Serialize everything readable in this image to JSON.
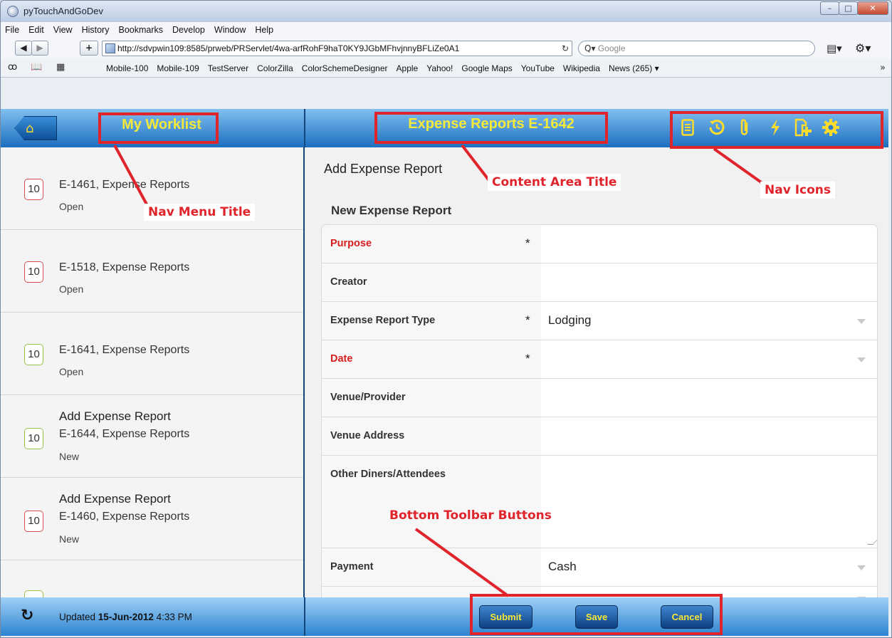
{
  "window": {
    "title": "pyTouchAndGoDev",
    "controls": {
      "minimize": "–",
      "maximize": "□",
      "close": "✕"
    }
  },
  "menubar": [
    "File",
    "Edit",
    "View",
    "History",
    "Bookmarks",
    "Develop",
    "Window",
    "Help"
  ],
  "toolbar": {
    "back": "◀",
    "forward": "▶",
    "add": "+",
    "url": "http://sdvpwin109:8585/prweb/PRServlet/4wa-arfRohF9haT0KY9JGbMFhvjnnyBFLiZe0A1",
    "reload": "↻",
    "search_placeholder": "Google",
    "search_glyph": "Q▾",
    "page_menu": "▤▾",
    "gear_menu": "⚙▾"
  },
  "bookmarks": {
    "items": [
      "Mobile-100",
      "Mobile-109",
      "TestServer",
      "ColorZilla",
      "ColorSchemeDesigner",
      "Apple",
      "Yahoo!",
      "Google Maps",
      "YouTube",
      "Wikipedia",
      "News (265) ▾"
    ],
    "more": "»"
  },
  "app": {
    "nav_title": "My Worklist",
    "content_title": "Expense Reports E-1642",
    "nav_icons": [
      "document-icon",
      "history-icon",
      "paperclip-icon",
      "lightning-icon",
      "add-page-icon",
      "gear-icon"
    ],
    "worklist": [
      {
        "priority": "10",
        "title": "",
        "line1": "E-1461, Expense Reports",
        "status": "Open",
        "badge": "red"
      },
      {
        "priority": "10",
        "title": "",
        "line1": "E-1518, Expense Reports",
        "status": "Open",
        "badge": "red"
      },
      {
        "priority": "10",
        "title": "",
        "line1": "E-1641, Expense Reports",
        "status": "Open",
        "badge": "green"
      },
      {
        "priority": "10",
        "title": "Add Expense Report",
        "line1": "E-1644, Expense Reports",
        "status": "New",
        "badge": "green"
      },
      {
        "priority": "10",
        "title": "Add Expense Report",
        "line1": "E-1460, Expense Reports",
        "status": "New",
        "badge": "red"
      },
      {
        "priority": "",
        "title": "",
        "line1": "",
        "status": "",
        "badge": "green"
      }
    ],
    "content": {
      "heading": "Add Expense Report",
      "subheading": "New Expense Report",
      "fields": [
        {
          "label": "Purpose",
          "required": true,
          "value": "",
          "dropdown": false
        },
        {
          "label": "Creator",
          "required": false,
          "value": "",
          "dropdown": false
        },
        {
          "label": "Expense Report Type",
          "required": true,
          "value": "Lodging",
          "dropdown": true
        },
        {
          "label": "Date",
          "required": true,
          "value": "",
          "dropdown": true
        },
        {
          "label": "Venue/Provider",
          "required": false,
          "value": "",
          "dropdown": false
        },
        {
          "label": "Venue Address",
          "required": false,
          "value": "",
          "dropdown": false
        },
        {
          "label": "Other Diners/Attendees",
          "required": false,
          "value": "",
          "dropdown": false
        },
        {
          "label": "Payment",
          "required": false,
          "value": "Cash",
          "dropdown": true
        }
      ],
      "required_marker": "*"
    },
    "bottom": {
      "updated_prefix": "Updated ",
      "updated_date": "15-Jun-2012",
      "updated_time": " 4:33 PM",
      "submit": "Submit",
      "save": "Save",
      "cancel": "Cancel"
    }
  },
  "annotations": {
    "nav_menu_title": "Nav Menu Title",
    "content_area_title": "Content Area Title",
    "nav_icons": "Nav Icons",
    "bottom_toolbar_buttons": "Bottom Toolbar Buttons",
    "color": "#e0242b"
  },
  "colors": {
    "header_gradient_top": "#82bff0",
    "header_gradient_bottom": "#1b6fbf",
    "title_yellow": "#f5e93a",
    "required_red": "#d62020"
  }
}
